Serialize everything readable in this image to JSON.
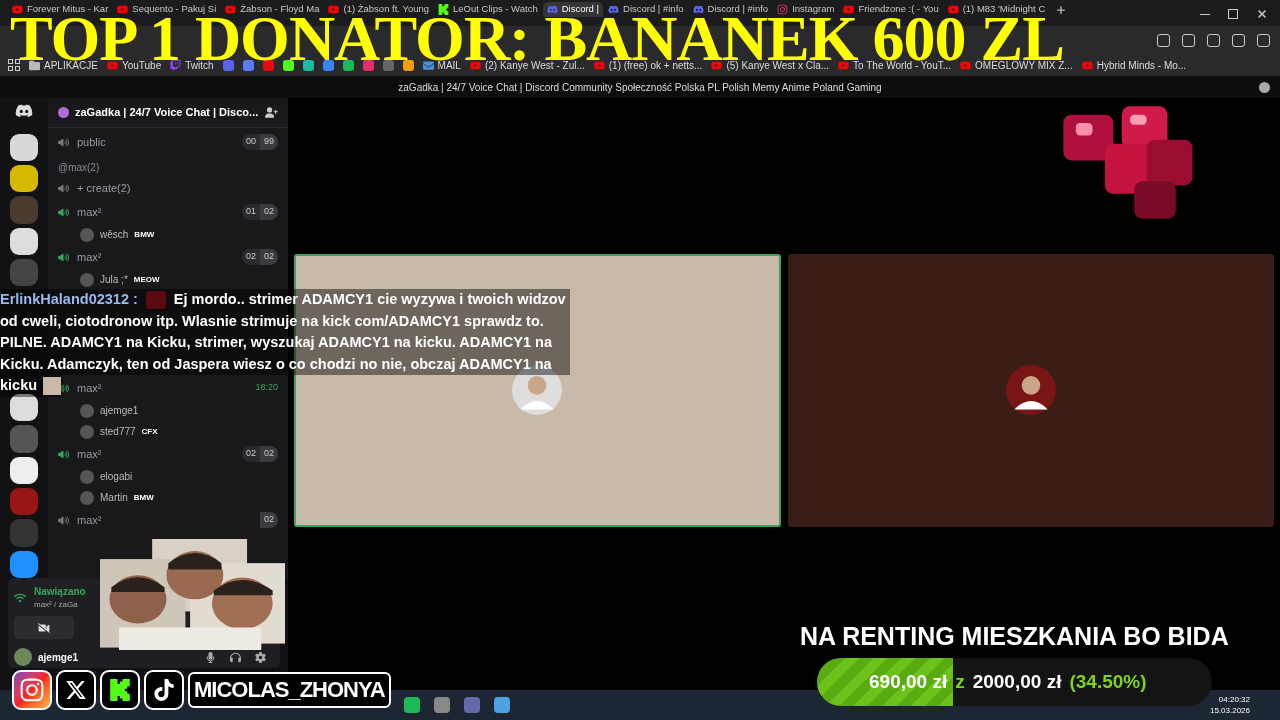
{
  "banner": {
    "text": "TOP 1 DONATOR: BANANEK 600 ZL"
  },
  "tabs": [
    {
      "title": "Forever Mitus - Kar",
      "kind": "youtube",
      "selected": false
    },
    {
      "title": "Sequento - Pakuj Si",
      "kind": "youtube",
      "selected": false
    },
    {
      "title": "Żabson - Floyd Ma",
      "kind": "youtube",
      "selected": false
    },
    {
      "title": "(1) Żabson ft. Young",
      "kind": "youtube",
      "selected": false
    },
    {
      "title": "LeOut Clips - Watch",
      "kind": "kick",
      "selected": false
    },
    {
      "title": "Discord |",
      "kind": "discord",
      "selected": true
    },
    {
      "title": "Discord | #info",
      "kind": "discord",
      "selected": false
    },
    {
      "title": "Discord | #info",
      "kind": "discord",
      "selected": false
    },
    {
      "title": "Instagram",
      "kind": "instagram",
      "selected": false
    },
    {
      "title": "Friendzone :( - You",
      "kind": "youtube",
      "selected": false
    },
    {
      "title": "(1) M83 'Midnight C",
      "kind": "youtube",
      "selected": false
    }
  ],
  "bookmarks": [
    {
      "label": "APLIKACJE",
      "kind": "folder"
    },
    {
      "label": "YouTube",
      "kind": "youtube"
    },
    {
      "label": "Twitch",
      "kind": "twitch"
    },
    {
      "label": "MAIL",
      "kind": "mail"
    },
    {
      "label": "(2) Kanye West - Zul...",
      "kind": "youtube"
    },
    {
      "label": "(1) (free) ok + netts...",
      "kind": "youtube"
    },
    {
      "label": "(5) Kanye West x Cla...",
      "kind": "youtube"
    },
    {
      "label": "To The World - YouT...",
      "kind": "youtube"
    },
    {
      "label": "OMEGLOWY MIX Z...",
      "kind": "youtube"
    },
    {
      "label": "Hybrid Minds - Mo...",
      "kind": "youtube"
    }
  ],
  "page_title": "zaGadka | 24/7 Voice Chat | Discord Community Społeczność Polska PL Polish Memy Anime Poland Gaming",
  "discord": {
    "server_name": "zaGadka | 24/7 Voice Chat | Disco...",
    "items": [
      {
        "kind": "channel",
        "name": "public",
        "counts": [
          "00",
          "99"
        ]
      },
      {
        "kind": "category",
        "name": "@max(2)"
      },
      {
        "kind": "channel",
        "name": "+ create(2)"
      },
      {
        "kind": "channel",
        "name": "max²",
        "counts": [
          "01",
          "02"
        ],
        "children": [
          {
            "name": "wěsch",
            "tag": "BMW"
          }
        ]
      },
      {
        "kind": "channel",
        "name": "max²",
        "counts": [
          "02",
          "02"
        ],
        "children": [
          {
            "name": "Jula ;*",
            "tag": "MEOW"
          }
        ]
      },
      {
        "kind": "gap"
      },
      {
        "kind": "channel",
        "name": "max²",
        "time": "18:20",
        "children": [
          {
            "name": "ajemge1"
          },
          {
            "name": "sted777",
            "tag": "CFX"
          }
        ]
      },
      {
        "kind": "channel",
        "name": "max²",
        "counts": [
          "02",
          "02"
        ],
        "children": [
          {
            "name": "elogabi"
          },
          {
            "name": "Martin",
            "tag": "BMW"
          }
        ]
      },
      {
        "kind": "channel",
        "name": "max²",
        "counts": [
          "02"
        ]
      }
    ],
    "voice_status": "Nawiązano",
    "voice_location": "max² / zaGa",
    "user": "ajemge1"
  },
  "chat": {
    "user": "ErlinkHaland02312 :",
    "lines": [
      "Ej mordo.. strimer ADAMCY1 cie wyzywa i twoich widzov",
      "od cweli, ciotodronow itp. Wlasnie strimuje na kick com/ADAMCY1 sprawdz to.",
      "PILNE. ADAMCY1 na Kicku, strimer, wyszukaj ADAMCY1 na kicku. ADAMCY1 na",
      "Kicku. Adamczyk, ten od Jaspera wiesz o co chodzi no nie, obczaj ADAMCY1 na",
      "kicku"
    ]
  },
  "tiles": [
    {
      "speaking": true
    },
    {
      "speaking": false
    }
  ],
  "socials": {
    "handle": "MICOLAS_ZHONYA"
  },
  "goal": {
    "title": "NA RENTING MIESZKANIA BO BIDA",
    "level": 0.345,
    "raised": "690,00 zł",
    "sep": "z",
    "target": "2000,00 zł",
    "percent": "(34.50%)"
  },
  "taskbar": {
    "time": "04:20:32",
    "date": "15.03.2026"
  }
}
